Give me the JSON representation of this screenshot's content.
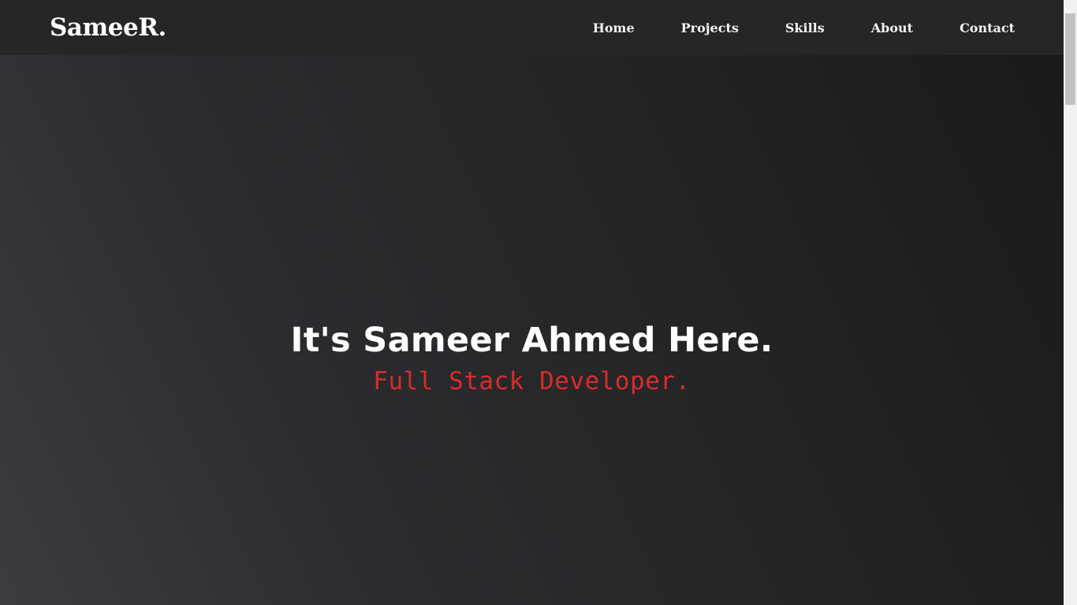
{
  "navbar": {
    "brand": "SameeR.",
    "links": [
      {
        "label": "Home"
      },
      {
        "label": "Projects"
      },
      {
        "label": "Skills"
      },
      {
        "label": "About"
      },
      {
        "label": "Contact"
      }
    ]
  },
  "hero": {
    "title": "It's Sameer Ahmed Here.",
    "subtitle": "Full Stack Developer."
  },
  "colors": {
    "navbar_bg": "#262626",
    "accent_red": "#d92b2b",
    "text_white": "#ffffff"
  }
}
